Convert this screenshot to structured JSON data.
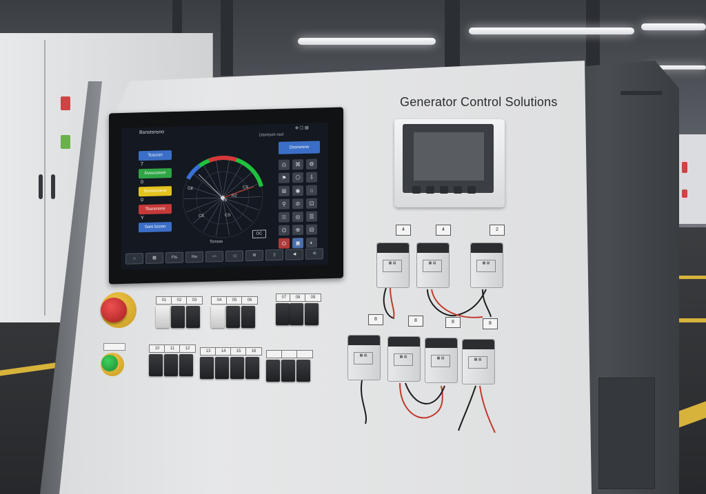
{
  "brand": {
    "title": "Generator Control Solutions"
  },
  "hmi": {
    "title": "Bsnstsnsno",
    "subtitle": "Dtsrtisoh nsd",
    "status": "⊕ ▢ ▤",
    "side_buttons": [
      {
        "label": "Tcsccsn",
        "color": "#3b6fc7",
        "value": "7"
      },
      {
        "label": "Dvsvcsnom",
        "color": "#2fa545",
        "value": "0"
      },
      {
        "label": "Srcmsoneus",
        "color": "#e3c31e",
        "value": "0"
      },
      {
        "label": "Tbsnsnons",
        "color": "#c63a3a",
        "value": "Y"
      },
      {
        "label": "Sore bccen",
        "color": "#3b6fc7",
        "value": ""
      }
    ],
    "right_button": "Dssnsrsno",
    "gauge": {
      "labels": [
        "GE",
        "CS",
        "R2",
        "4S",
        "CE",
        "CS",
        "Tcnsoo"
      ],
      "ok": "OC"
    },
    "keypad": [
      "⎙",
      "⌘",
      "⚙",
      "⚑",
      "⎔",
      "⇩",
      "⊞",
      "◉",
      "⌂",
      "⚲",
      "⊘",
      "⊡",
      "⚿",
      "◎",
      "☰",
      "⌬",
      "⊕",
      "⊟",
      "⛭",
      "▣",
      "◐"
    ],
    "bottom_buttons": [
      "⌂",
      "▦",
      "Fts",
      "Ihs",
      "▭",
      "◁",
      "⧉",
      "▯",
      "◀",
      "⟲"
    ]
  },
  "console": {
    "estop_tag": "",
    "start_tag": "",
    "switch_tags": [
      "01",
      "02",
      "03",
      "04",
      "05",
      "06",
      "07",
      "08",
      "09",
      "10",
      "11",
      "12",
      "13",
      "14",
      "15",
      "16"
    ]
  },
  "relays": {
    "tags_top": [
      "4",
      "4",
      "2"
    ],
    "tags_bottom": [
      "8",
      "8",
      "8",
      "8"
    ],
    "label": "▦ ▤"
  },
  "colors": {
    "estop": "#d63a3a",
    "start": "#2fb24a",
    "gauge_green": "#1fc23d",
    "gauge_red": "#d9363a",
    "gauge_blue": "#3a6fd9"
  }
}
